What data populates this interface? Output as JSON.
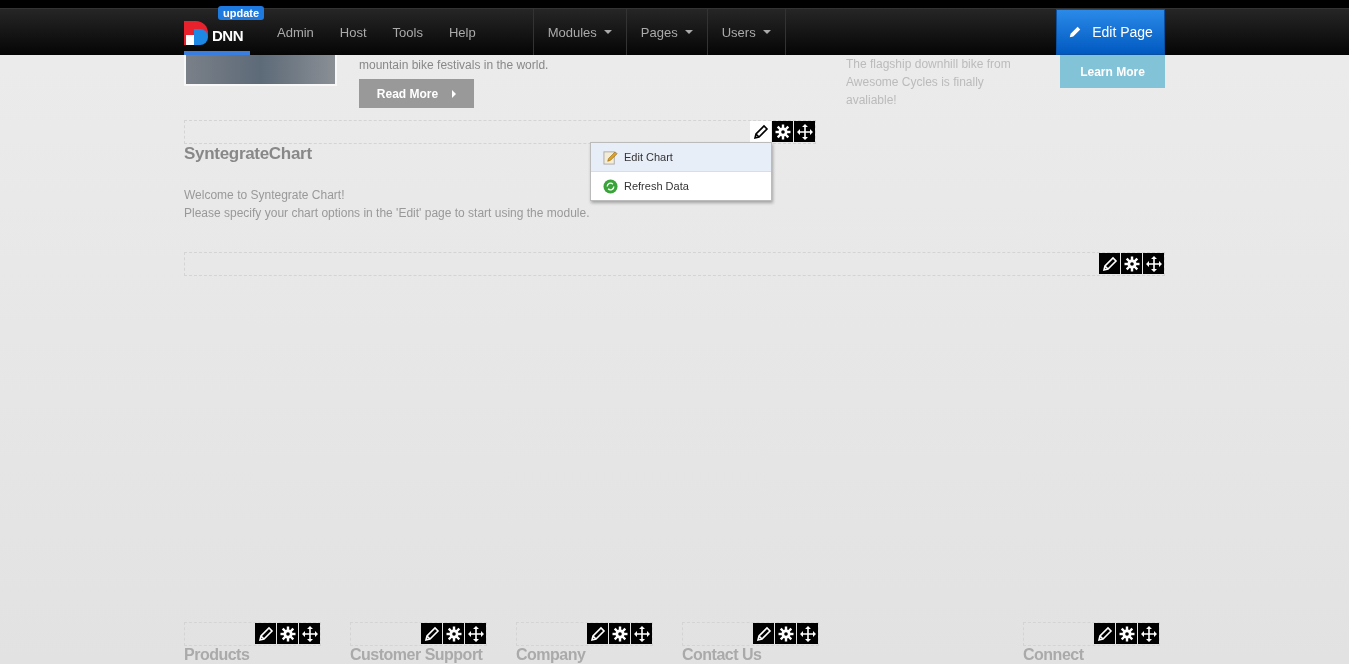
{
  "navbar": {
    "logo_text": "DNN",
    "badge": "update",
    "items": [
      {
        "label": "Admin",
        "kind": "link"
      },
      {
        "label": "Host",
        "kind": "link"
      },
      {
        "label": "Tools",
        "kind": "link"
      },
      {
        "label": "Help",
        "kind": "link"
      },
      {
        "label": "Modules",
        "kind": "dropdown"
      },
      {
        "label": "Pages",
        "kind": "dropdown"
      },
      {
        "label": "Users",
        "kind": "dropdown"
      }
    ],
    "edit_button": "Edit Page"
  },
  "banner": {
    "text": "mountain bike festivals in the world.",
    "button": "Read More",
    "side_text": "The flagship downhill bike from Awesome Cycles is finally avaliable!",
    "side_button": "Learn More"
  },
  "chart_module": {
    "title": "SyntegrateChart",
    "menu_open": true,
    "lines": [
      "Welcome to Syntegrate Chart!",
      "Please specify your chart options in the 'Edit' page to start using the module."
    ],
    "menu": [
      {
        "label": "Edit Chart",
        "kind": "edit",
        "selected": true
      },
      {
        "label": "Refresh Data",
        "kind": "refresh",
        "selected": false
      }
    ]
  },
  "empty_module": {
    "menu_open": false
  },
  "footer_modules": [
    {
      "title": "Products"
    },
    {
      "title": "Customer Support"
    },
    {
      "title": "Company"
    },
    {
      "title": "Contact Us"
    },
    {
      "title": "Connect"
    }
  ]
}
